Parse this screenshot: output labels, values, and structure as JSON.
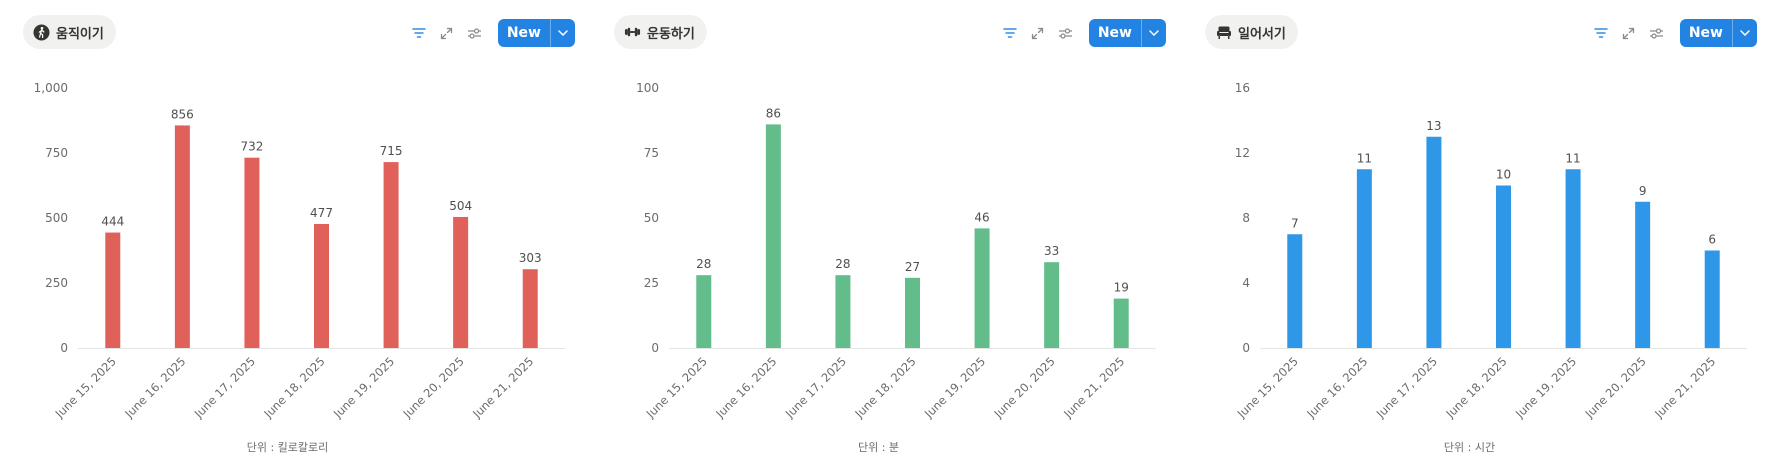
{
  "panels": [
    {
      "tab": {
        "label": "움직이기",
        "icon": "person-walking-icon"
      },
      "toolbar": {
        "new_label": "New",
        "filter_color": "#2e8de6"
      },
      "unit_label": "단위 : 킬로칼로리",
      "chart_data": {
        "type": "bar",
        "categories": [
          "June 15, 2025",
          "June 16, 2025",
          "June 17, 2025",
          "June 18, 2025",
          "June 19, 2025",
          "June 20, 2025",
          "June 21, 2025"
        ],
        "values": [
          444,
          856,
          732,
          477,
          715,
          504,
          303
        ],
        "ylim": [
          0,
          1000
        ],
        "yticks": [
          0,
          250,
          500,
          750,
          1000
        ],
        "ytick_labels": [
          "0",
          "250",
          "500",
          "750",
          "1,000"
        ],
        "color": "#e0605a",
        "grid": false,
        "title": "",
        "xlabel": "단위 : 킬로칼로리",
        "ylabel": ""
      }
    },
    {
      "tab": {
        "label": "운동하기",
        "icon": "dumbbell-icon"
      },
      "toolbar": {
        "new_label": "New",
        "filter_color": "#2e8de6"
      },
      "unit_label": "단위 : 분",
      "chart_data": {
        "type": "bar",
        "categories": [
          "June 15, 2025",
          "June 16, 2025",
          "June 17, 2025",
          "June 18, 2025",
          "June 19, 2025",
          "June 20, 2025",
          "June 21, 2025"
        ],
        "values": [
          28,
          86,
          28,
          27,
          46,
          33,
          19
        ],
        "ylim": [
          0,
          100
        ],
        "yticks": [
          0,
          25,
          50,
          75,
          100
        ],
        "ytick_labels": [
          "0",
          "25",
          "50",
          "75",
          "100"
        ],
        "color": "#62bd8a",
        "grid": false,
        "title": "",
        "xlabel": "단위 : 분",
        "ylabel": ""
      }
    },
    {
      "tab": {
        "label": "일어서기",
        "icon": "armchair-icon"
      },
      "toolbar": {
        "new_label": "New",
        "filter_color": "#2e8de6"
      },
      "unit_label": "단위 : 시간",
      "chart_data": {
        "type": "bar",
        "categories": [
          "June 15, 2025",
          "June 16, 2025",
          "June 17, 2025",
          "June 18, 2025",
          "June 19, 2025",
          "June 20, 2025",
          "June 21, 2025"
        ],
        "values": [
          7,
          11,
          13,
          10,
          11,
          9,
          6
        ],
        "ylim": [
          0,
          16
        ],
        "yticks": [
          0,
          4,
          8,
          12,
          16
        ],
        "ytick_labels": [
          "0",
          "4",
          "8",
          "12",
          "16"
        ],
        "color": "#2f97e8",
        "grid": false,
        "title": "",
        "xlabel": "단위 : 시간",
        "ylabel": ""
      }
    }
  ]
}
